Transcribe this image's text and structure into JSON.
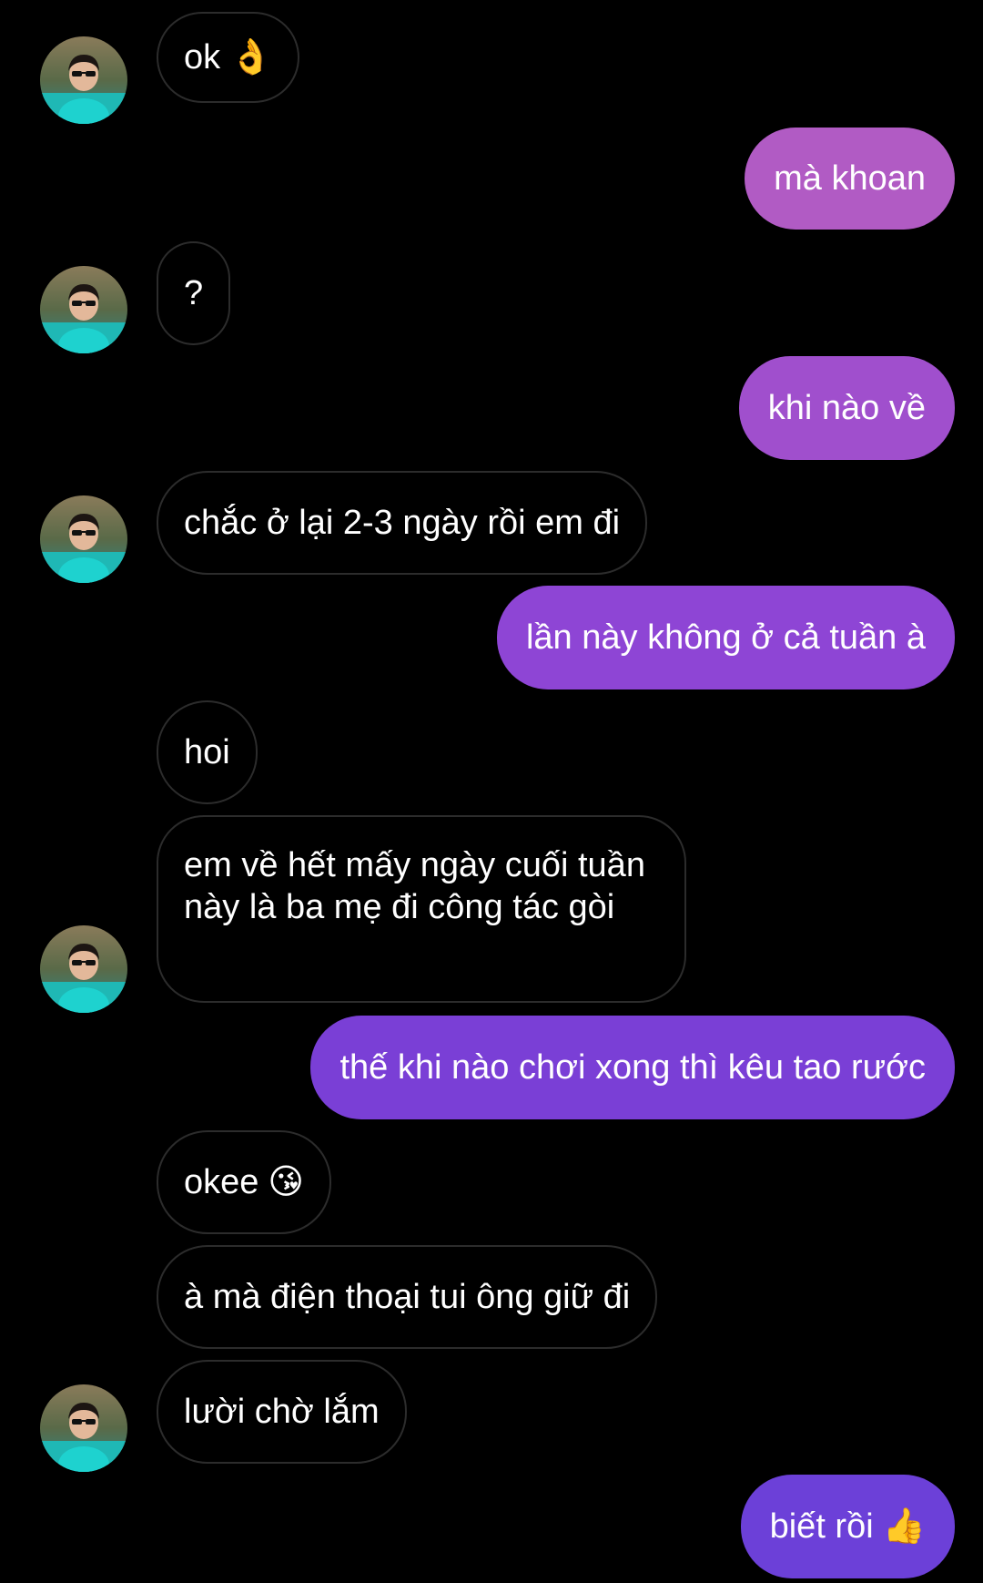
{
  "messages": [
    {
      "text": "ok",
      "emoji": "👌"
    },
    {
      "text": "mà khoan"
    },
    {
      "text": "?"
    },
    {
      "text": "khi nào về"
    },
    {
      "text": "chắc ở lại 2-3 ngày rồi em đi"
    },
    {
      "text": "lần này không ở cả tuần à"
    },
    {
      "text": "hoi"
    },
    {
      "text": "em về hết mấy ngày cuối tuần này là ba mẹ đi công tác gòi"
    },
    {
      "text": "thế khi nào chơi xong thì kêu tao rước"
    },
    {
      "text": "okee",
      "emoji": "😘"
    },
    {
      "text": "à mà điện thoại tui ông giữ đi"
    },
    {
      "text": "lười chờ lắm"
    },
    {
      "text": "biết rồi",
      "emoji": "👍"
    }
  ],
  "colors": {
    "background": "#000000",
    "incoming_border": "#2c2c2c",
    "outgoing_light": "#b15bc4",
    "outgoing_mid": "#8a4ad6",
    "outgoing_dark": "#6c40d8"
  }
}
